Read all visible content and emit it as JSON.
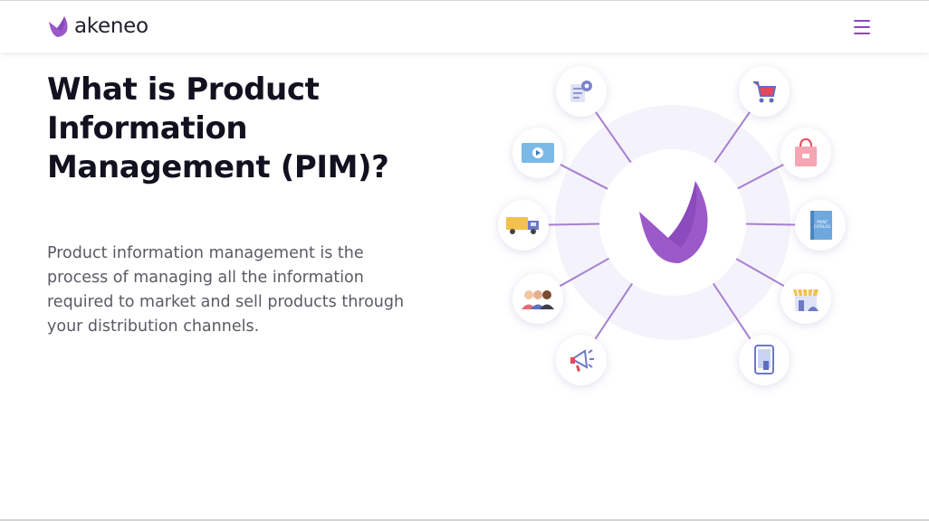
{
  "header": {
    "brand": "akeneo",
    "logo_icon": "akeneo-logo-icon",
    "menu_icon": "hamburger-menu-icon"
  },
  "hero": {
    "title": "What is Product Information Management (PIM)?",
    "description": "Product information management is the process of managing all the information required to market and sell products through your distribution channels."
  },
  "diagram": {
    "center_icon": "akeneo-logo-icon",
    "nodes": [
      {
        "icon": "document-settings-icon"
      },
      {
        "icon": "video-player-icon"
      },
      {
        "icon": "delivery-truck-icon"
      },
      {
        "icon": "people-group-icon"
      },
      {
        "icon": "megaphone-icon"
      },
      {
        "icon": "shopping-cart-icon"
      },
      {
        "icon": "shopping-bag-icon"
      },
      {
        "icon": "catalog-book-icon"
      },
      {
        "icon": "storefront-icon"
      },
      {
        "icon": "tablet-device-icon"
      }
    ],
    "book_label": "PRINT CATALOG"
  },
  "colors": {
    "accent": "#8b45c4",
    "logo_purple": "#9b59c9",
    "title": "#11111f",
    "body_text": "#5a5a64"
  }
}
